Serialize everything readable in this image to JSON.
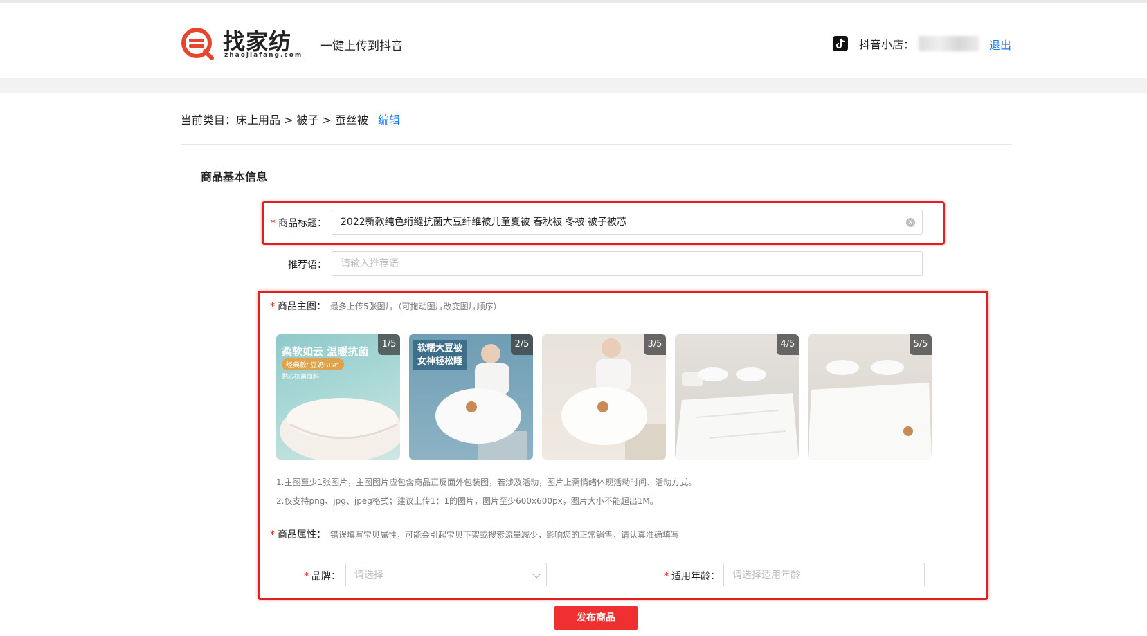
{
  "header": {
    "logo_cn": "找家纺",
    "logo_en": "zhaojiafang.com",
    "tagline": "一键上传到抖音",
    "shop_label": "抖音小店：",
    "logout": "退出"
  },
  "category": {
    "text": "当前类目：床上用品 > 被子 > 蚕丝被",
    "edit": "编辑"
  },
  "section_title": "商品基本信息",
  "form": {
    "title_label": "商品标题：",
    "title_value": "2022新款纯色绗缝抗菌大豆纤维被儿童夏被 春秋被 冬被 被子被芯",
    "slogan_label": "推荐语：",
    "slogan_placeholder": "请输入推荐语",
    "main_image_label": "商品主图：",
    "main_image_hint": "最多上传5张图片（可拖动图片改变图片顺序）",
    "images": [
      {
        "index": "1/5",
        "line1": "柔软如云  温暖抗菌",
        "line2": "经典款“豆奶SPA”",
        "line3": "贴心抗菌面料"
      },
      {
        "index": "2/5",
        "line1": "软糯大豆被",
        "line2": "女神轻松睡"
      },
      {
        "index": "3/5"
      },
      {
        "index": "4/5"
      },
      {
        "index": "5/5"
      }
    ],
    "notes": [
      "1.主图至少1张图片，主图图片应包含商品正反面外包装图，若涉及活动，图片上需情绪体现活动时间、活动方式。",
      "2.仅支持png、jpg、jpeg格式；建议上传1：1的图片，图片至少600x600px，图片大小不能超出1M。"
    ],
    "attr_label": "商品属性：",
    "attr_hint": "错误填写宝贝属性，可能会引起宝贝下架或搜索流量减少，影响您的正常销售，请认真准确填写",
    "brand_label": "品牌：",
    "brand_placeholder": "请选择",
    "age_label": "适用年龄：",
    "age_placeholder": "请选择适用年龄",
    "required_mark": "*"
  },
  "publish_button": "发布商品",
  "colors": {
    "accent": "#1677ff",
    "highlight": "#e02020",
    "primary_button": "#f03030"
  }
}
